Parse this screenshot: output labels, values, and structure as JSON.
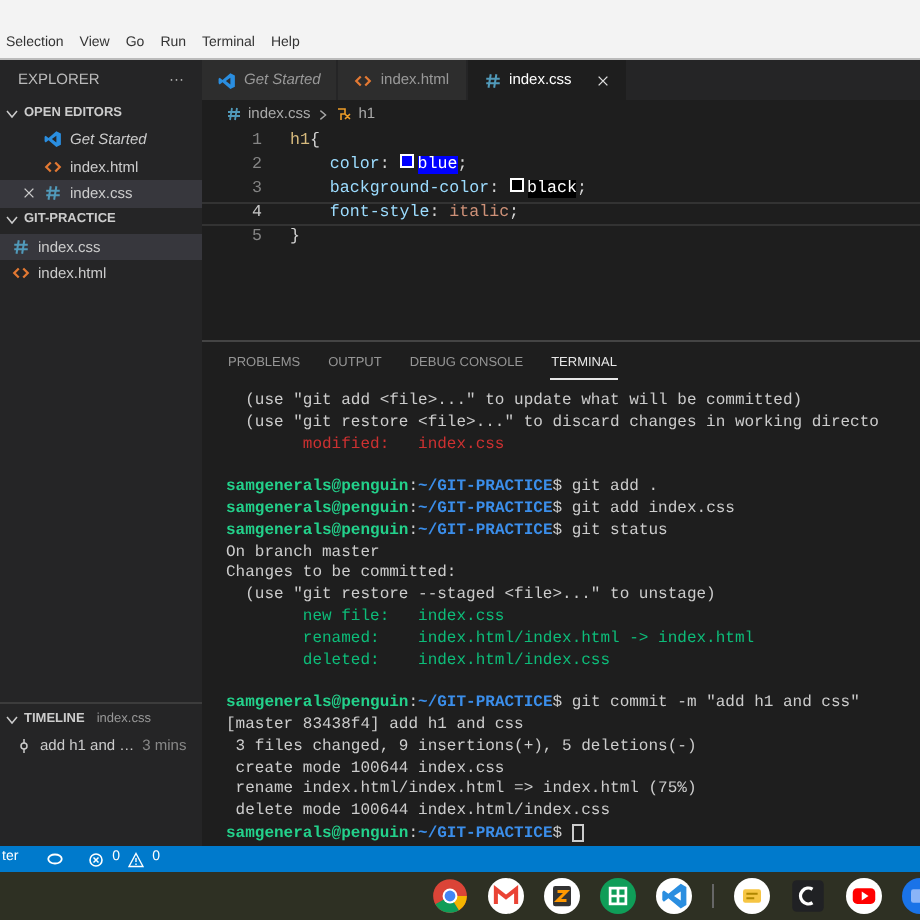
{
  "menu": [
    "Selection",
    "View",
    "Go",
    "Run",
    "Terminal",
    "Help"
  ],
  "sidebar": {
    "title": "EXPLORER",
    "more": "···",
    "sections": [
      {
        "title": "OPEN EDITORS",
        "expanded": true,
        "items": [
          {
            "label": "Get Started",
            "kind": "vscode",
            "preview": true,
            "selected": false
          },
          {
            "label": "index.html",
            "kind": "html",
            "preview": false,
            "selected": false
          },
          {
            "label": "index.css",
            "kind": "css",
            "preview": false,
            "selected": true
          }
        ]
      },
      {
        "title": "GIT-PRACTICE",
        "expanded": true,
        "items": [
          {
            "label": "index.css",
            "kind": "css",
            "preview": false,
            "selected": true
          },
          {
            "label": "index.html",
            "kind": "html",
            "preview": false,
            "selected": false
          }
        ]
      }
    ],
    "timeline": {
      "title": "TIMELINE",
      "file": "index.css",
      "expanded": true,
      "entries": [
        {
          "label": "add h1 and …",
          "time": "3 mins"
        }
      ]
    }
  },
  "tabs": [
    {
      "label": "Get Started",
      "kind": "vscode",
      "preview": true,
      "selected": false
    },
    {
      "label": "index.html",
      "kind": "html",
      "preview": false,
      "selected": false
    },
    {
      "label": "index.css",
      "kind": "css",
      "preview": false,
      "selected": true
    }
  ],
  "breadcrumb": [
    {
      "label": "index.css",
      "kind": "css"
    },
    {
      "label": "h1",
      "kind": "symbol"
    }
  ],
  "code": [
    {
      "number": "1",
      "current": false,
      "tokens": [
        {
          "kind": "selector",
          "text": "h1"
        },
        {
          "kind": "punct",
          "text": "{"
        }
      ]
    },
    {
      "number": "2",
      "current": false,
      "tokens": [
        {
          "kind": "property",
          "text": "color"
        },
        {
          "kind": "punct",
          "text": ": "
        },
        {
          "kind": "swatch",
          "color": "#0000ff"
        },
        {
          "kind": "value",
          "text": "blue",
          "highlighted": true
        },
        {
          "kind": "punct",
          "text": ";"
        }
      ]
    },
    {
      "number": "3",
      "current": false,
      "tokens": [
        {
          "kind": "property",
          "text": "background-color"
        },
        {
          "kind": "punct",
          "text": ": "
        },
        {
          "kind": "swatch",
          "color": "#000000"
        },
        {
          "kind": "value",
          "text": "black",
          "highlighted": true
        },
        {
          "kind": "punct",
          "text": ";"
        }
      ]
    },
    {
      "number": "4",
      "current": true,
      "tokens": [
        {
          "kind": "property",
          "text": "font-style"
        },
        {
          "kind": "punct",
          "text": ": "
        },
        {
          "kind": "value",
          "text": "italic",
          "highlighted": false
        },
        {
          "kind": "punct",
          "text": ";"
        }
      ]
    },
    {
      "number": "5",
      "current": false,
      "tokens": [
        {
          "kind": "punct",
          "text": "}"
        }
      ]
    }
  ],
  "panel": {
    "tabs": [
      {
        "label": "PROBLEMS",
        "selected": false
      },
      {
        "label": "OUTPUT",
        "selected": false
      },
      {
        "label": "DEBUG CONSOLE",
        "selected": false
      },
      {
        "label": "TERMINAL",
        "selected": true
      }
    ],
    "terminal": [
      {
        "kind": "text",
        "segments": [
          {
            "kind": "plain",
            "text": "  (use \"git add <file>...\" to update what will be committed)"
          }
        ]
      },
      {
        "kind": "text",
        "segments": [
          {
            "kind": "plain",
            "text": "  (use \"git restore <file>...\" to discard changes in working directo"
          }
        ]
      },
      {
        "kind": "text",
        "segments": [
          {
            "kind": "red",
            "text": "        modified:   index.css"
          }
        ]
      },
      {
        "kind": "blank"
      },
      {
        "kind": "text",
        "segments": [
          {
            "kind": "user",
            "text": "samgenerals@penguin"
          },
          {
            "kind": "plain",
            "text": ":"
          },
          {
            "kind": "path",
            "text": "~/GIT-PRACTICE"
          },
          {
            "kind": "plain",
            "text": "$ git add ."
          }
        ]
      },
      {
        "kind": "text",
        "segments": [
          {
            "kind": "user",
            "text": "samgenerals@penguin"
          },
          {
            "kind": "plain",
            "text": ":"
          },
          {
            "kind": "path",
            "text": "~/GIT-PRACTICE"
          },
          {
            "kind": "plain",
            "text": "$ git add index.css"
          }
        ]
      },
      {
        "kind": "text",
        "segments": [
          {
            "kind": "user",
            "text": "samgenerals@penguin"
          },
          {
            "kind": "plain",
            "text": ":"
          },
          {
            "kind": "path",
            "text": "~/GIT-PRACTICE"
          },
          {
            "kind": "plain",
            "text": "$ git status"
          }
        ]
      },
      {
        "kind": "text",
        "segments": [
          {
            "kind": "plain",
            "text": "On branch master"
          }
        ]
      },
      {
        "kind": "text",
        "segments": [
          {
            "kind": "plain",
            "text": "Changes to be committed:"
          }
        ]
      },
      {
        "kind": "text",
        "segments": [
          {
            "kind": "plain",
            "text": "  (use \"git restore --staged <file>...\" to unstage)"
          }
        ]
      },
      {
        "kind": "text",
        "segments": [
          {
            "kind": "green",
            "text": "        new file:   index.css"
          }
        ]
      },
      {
        "kind": "text",
        "segments": [
          {
            "kind": "green",
            "text": "        renamed:    index.html/index.html -> index.html"
          }
        ]
      },
      {
        "kind": "text",
        "segments": [
          {
            "kind": "green",
            "text": "        deleted:    index.html/index.css"
          }
        ]
      },
      {
        "kind": "blank"
      },
      {
        "kind": "text",
        "segments": [
          {
            "kind": "user",
            "text": "samgenerals@penguin"
          },
          {
            "kind": "plain",
            "text": ":"
          },
          {
            "kind": "path",
            "text": "~/GIT-PRACTICE"
          },
          {
            "kind": "plain",
            "text": "$ git commit -m \"add h1 and css\""
          }
        ]
      },
      {
        "kind": "text",
        "segments": [
          {
            "kind": "plain",
            "text": "[master 83438f4] add h1 and css"
          }
        ]
      },
      {
        "kind": "text",
        "segments": [
          {
            "kind": "plain",
            "text": " 3 files changed, 9 insertions(+), 5 deletions(-)"
          }
        ]
      },
      {
        "kind": "text",
        "segments": [
          {
            "kind": "plain",
            "text": " create mode 100644 index.css"
          }
        ]
      },
      {
        "kind": "text",
        "segments": [
          {
            "kind": "plain",
            "text": " rename index.html/index.html => index.html (75%)"
          }
        ]
      },
      {
        "kind": "text",
        "segments": [
          {
            "kind": "plain",
            "text": " delete mode 100644 index.html/index.css"
          }
        ]
      },
      {
        "kind": "prompt",
        "segments": [
          {
            "kind": "user",
            "text": "samgenerals@penguin"
          },
          {
            "kind": "plain",
            "text": ":"
          },
          {
            "kind": "path",
            "text": "~/GIT-PRACTICE"
          },
          {
            "kind": "plain",
            "text": "$ "
          }
        ]
      }
    ]
  },
  "status_bar": {
    "branch_text": "ter",
    "errors": "0",
    "warnings": "0"
  },
  "shelf": [
    {
      "kind": "chrome"
    },
    {
      "kind": "mail"
    },
    {
      "kind": "editor"
    },
    {
      "kind": "sheet"
    },
    {
      "kind": "vscode"
    },
    {
      "kind": "divider"
    },
    {
      "kind": "note"
    },
    {
      "kind": "console"
    },
    {
      "kind": "video"
    },
    {
      "kind": "files"
    }
  ]
}
